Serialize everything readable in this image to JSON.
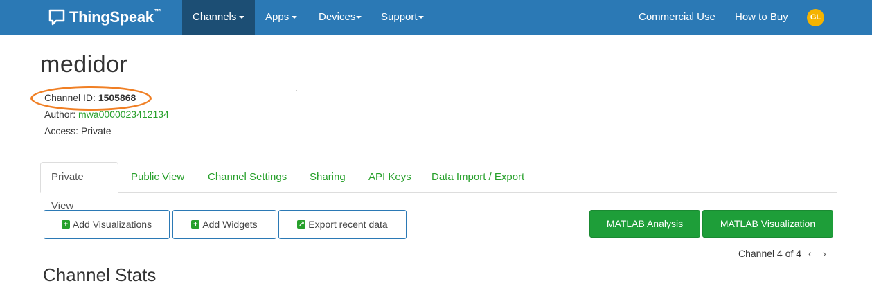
{
  "navbar": {
    "brand": "ThingSpeak",
    "brand_tm": "™",
    "items": [
      {
        "label": "Channels",
        "dropdown": true,
        "active": true
      },
      {
        "label": "Apps",
        "dropdown": true
      },
      {
        "label": "Devices",
        "dropdown": true
      },
      {
        "label": "Support",
        "dropdown": true
      }
    ],
    "right_items": [
      "Commercial Use",
      "How to Buy"
    ],
    "avatar_initials": "GL",
    "colors": {
      "bar": "#2b79b5",
      "active": "#1c4e74",
      "avatar": "#f5b300"
    }
  },
  "channel": {
    "name": "medidor",
    "id_label": "Channel ID:",
    "id_value": "1505868",
    "author_label": "Author:",
    "author_value": "mwa0000023412134",
    "access_label": "Access:",
    "access_value": "Private"
  },
  "tabs": [
    "Private View",
    "Public View",
    "Channel Settings",
    "Sharing",
    "API Keys",
    "Data Import / Export"
  ],
  "actions": {
    "add_visualizations": "Add Visualizations",
    "add_widgets": "Add Widgets",
    "export_recent_data": "Export recent data",
    "matlab_analysis": "MATLAB Analysis",
    "matlab_visualization": "MATLAB Visualization"
  },
  "pager": {
    "text": "Channel 4 of 4",
    "prev": "‹",
    "next": "›"
  },
  "section_title": "Channel Stats",
  "icons": [
    "chat-bubble-icon",
    "caret-down-icon",
    "plus-square-icon",
    "export-arrow-icon",
    "chevron-left-icon",
    "chevron-right-icon"
  ],
  "accent_green": "#1e9e39",
  "link_green": "#27a02b",
  "highlight_color": "#f07f24"
}
